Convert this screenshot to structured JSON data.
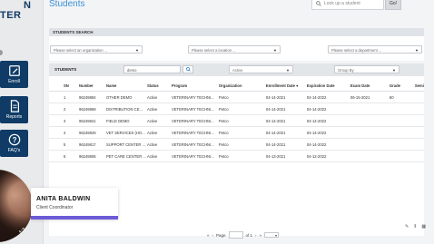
{
  "app": {
    "logo_line1": "N",
    "logo_line2": "TER"
  },
  "page_title": "Students",
  "top_search": {
    "placeholder": "Look up a student",
    "go_label": "Go!"
  },
  "sidebar": {
    "items": [
      {
        "label": "Enroll",
        "icon": "edit-icon"
      },
      {
        "label": "Reports",
        "icon": "document-icon"
      },
      {
        "label": "FAQ's",
        "icon": "help-icon"
      }
    ]
  },
  "search_section": {
    "title": "STUDENTS SEARCH",
    "organization_placeholder": "Please select an organization ...",
    "location_placeholder": "Please select a location ...",
    "department_placeholder": "Please select a department ..."
  },
  "students_section": {
    "title": "STUDENTS",
    "search_value": "demo",
    "status_value": "Active",
    "group_by_value": "Group By"
  },
  "table": {
    "headers": [
      "SN",
      "Number",
      "Name",
      "Status",
      "Program",
      "Organization",
      "Enrollment Date",
      "Expiration Date",
      "Exam Date",
      "Grade",
      "Semi"
    ],
    "rows": [
      [
        "1",
        "96249884",
        "OTHER DEMO",
        "Active",
        "VETERINARY TECHNI...",
        "Petco",
        "04-14-2021",
        "04-14-2022",
        "06-15-2021",
        "60",
        ""
      ],
      [
        "2",
        "96249868",
        "DISTRIBUTION CE...",
        "Active",
        "VETERINARY TECHNI...",
        "Petco",
        "04-14-2021",
        "04-14-2022",
        "",
        "",
        ""
      ],
      [
        "3",
        "96249841",
        "FIELD DEMO",
        "Active",
        "VETERINARY TECHNI...",
        "Petco",
        "04-14-2021",
        "04-14-2022",
        "",
        "",
        ""
      ],
      [
        "4",
        "96249829",
        "VET SERVICES (HO...",
        "Active",
        "VETERINARY TECHNI...",
        "Petco",
        "04-14-2021",
        "04-14-2022",
        "",
        "",
        ""
      ],
      [
        "5",
        "96249817",
        "SUPPORT CENTER ...",
        "Active",
        "VETERINARY TECHNI...",
        "Petco",
        "04-14-2021",
        "04-14-2022",
        "",
        "",
        ""
      ],
      [
        "6",
        "96249806",
        "PET CARE CENTER ...",
        "Active",
        "VETERINARY TECHNI...",
        "Petco",
        "04-13-2021",
        "04-12-2022",
        "",
        "",
        ""
      ]
    ]
  },
  "pager": {
    "page_label": "Page",
    "of_label": "of 1",
    "first": "«",
    "prev": "‹",
    "next": "›",
    "last": "»",
    "size_caret": "▾"
  },
  "presenter": {
    "name": "ANITA BALDWIN",
    "role": "Client Coordinator",
    "accent": "#6b5bd6"
  }
}
